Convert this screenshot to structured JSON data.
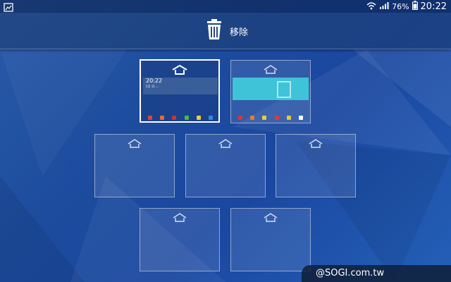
{
  "status_bar": {
    "battery_percent": "76%",
    "time": "20:22",
    "left_icon": "gallery-icon",
    "icons": [
      "wifi-icon",
      "signal-icon",
      "battery-icon"
    ]
  },
  "top_bar": {
    "remove_label": "移除",
    "remove_icon": "trash-icon"
  },
  "panels": [
    {
      "id": 1,
      "active": true,
      "type": "clock-home",
      "thumbnail_time": "20:22",
      "thumbnail_date": "5月 11 ..."
    },
    {
      "id": 2,
      "active": false,
      "type": "store-page"
    },
    {
      "id": 3,
      "active": false,
      "type": "empty"
    },
    {
      "id": 4,
      "active": false,
      "type": "empty"
    },
    {
      "id": 5,
      "active": false,
      "type": "empty"
    },
    {
      "id": 6,
      "active": false,
      "type": "empty"
    },
    {
      "id": 7,
      "active": false,
      "type": "empty"
    }
  ],
  "watermark": {
    "text": "@SOGI.com.tw"
  },
  "colors": {
    "accent": "#1d4c9e",
    "store_banner": "#3fc3d8"
  }
}
